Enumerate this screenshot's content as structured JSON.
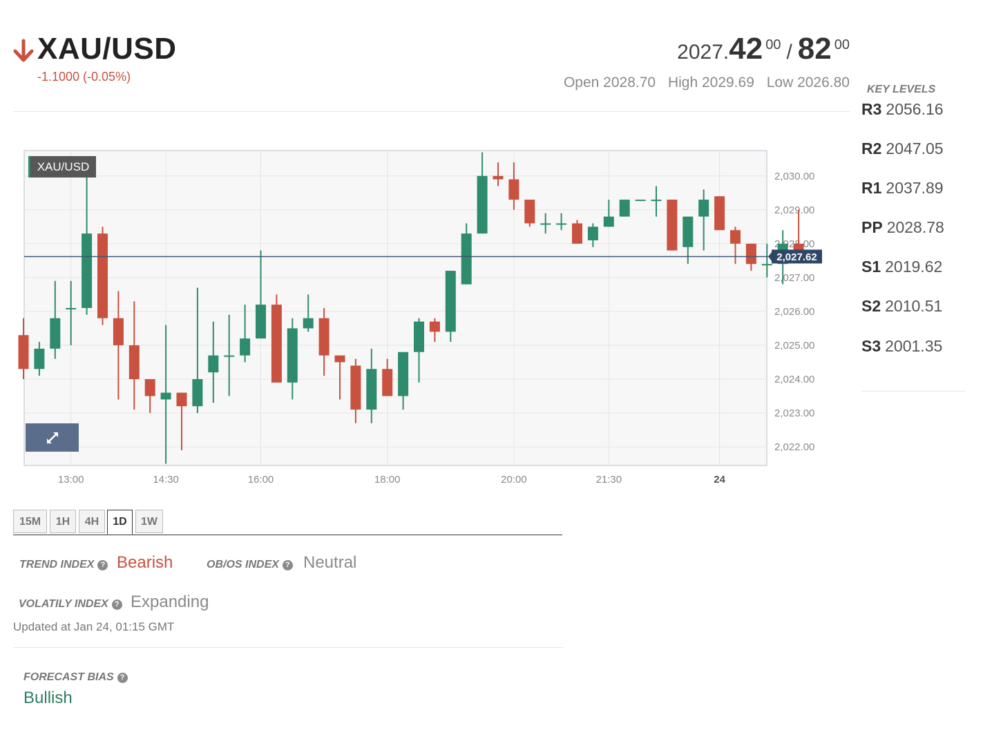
{
  "header": {
    "symbol": "XAU/USD",
    "change": "-1.1000 (-0.05%)",
    "bid_base": "2027.",
    "bid_big": "42",
    "bid_sup": "00",
    "slash": "/",
    "ask_big": "82",
    "ask_sup": "00",
    "open": "Open 2028.70",
    "high": "High 2029.69",
    "low": "Low 2026.80",
    "colors": {
      "down": "#c8513f",
      "up": "#2e8b6e"
    }
  },
  "key_levels": {
    "title": "KEY LEVELS",
    "items": [
      {
        "label": "R3",
        "value": "2056.16"
      },
      {
        "label": "R2",
        "value": "2047.05"
      },
      {
        "label": "R1",
        "value": "2037.89"
      },
      {
        "label": "PP",
        "value": "2028.78"
      },
      {
        "label": "S1",
        "value": "2019.62"
      },
      {
        "label": "S2",
        "value": "2010.51"
      },
      {
        "label": "S3",
        "value": "2001.35"
      }
    ]
  },
  "chart_data": {
    "type": "candlestick",
    "label": "XAU/USD",
    "current_price": 2027.62,
    "current_price_label": "2,027.62",
    "ylim": [
      2021.45,
      2030.75
    ],
    "y_ticks": [
      2022,
      2023,
      2024,
      2025,
      2026,
      2027,
      2028,
      2029,
      2030
    ],
    "y_tick_labels": [
      "2,022.00",
      "2,023.00",
      "2,024.00",
      "2,025.00",
      "2,026.00",
      "2,027.00",
      "2,028.00",
      "2,029.00",
      "2,030.00"
    ],
    "x_ticks": [
      {
        "label": "13:00",
        "index": 3,
        "bold": false
      },
      {
        "label": "14:30",
        "index": 9,
        "bold": false
      },
      {
        "label": "16:00",
        "index": 15,
        "bold": false
      },
      {
        "label": "18:00",
        "index": 23,
        "bold": false
      },
      {
        "label": "20:00",
        "index": 31,
        "bold": false
      },
      {
        "label": "21:30",
        "index": 37,
        "bold": false
      },
      {
        "label": "24",
        "index": 44,
        "bold": true
      }
    ],
    "candles": [
      {
        "o": 2025.3,
        "h": 2025.8,
        "l": 2024.0,
        "c": 2024.3
      },
      {
        "o": 2024.3,
        "h": 2025.1,
        "l": 2024.1,
        "c": 2024.9
      },
      {
        "o": 2024.9,
        "h": 2026.9,
        "l": 2024.6,
        "c": 2025.8
      },
      {
        "o": 2026.1,
        "h": 2026.9,
        "l": 2025.0,
        "c": 2026.1
      },
      {
        "o": 2026.1,
        "h": 2030.0,
        "l": 2025.9,
        "c": 2028.3
      },
      {
        "o": 2028.3,
        "h": 2028.5,
        "l": 2025.6,
        "c": 2025.8
      },
      {
        "o": 2025.8,
        "h": 2026.6,
        "l": 2023.4,
        "c": 2025.0
      },
      {
        "o": 2025.0,
        "h": 2026.3,
        "l": 2023.1,
        "c": 2024.0
      },
      {
        "o": 2024.0,
        "h": 2024.0,
        "l": 2023.0,
        "c": 2023.5
      },
      {
        "o": 2023.4,
        "h": 2025.6,
        "l": 2021.5,
        "c": 2023.6
      },
      {
        "o": 2023.6,
        "h": 2023.6,
        "l": 2021.9,
        "c": 2023.2
      },
      {
        "o": 2023.2,
        "h": 2026.7,
        "l": 2023.0,
        "c": 2024.0
      },
      {
        "o": 2024.2,
        "h": 2025.7,
        "l": 2023.3,
        "c": 2024.7
      },
      {
        "o": 2024.7,
        "h": 2025.9,
        "l": 2023.5,
        "c": 2024.7
      },
      {
        "o": 2024.7,
        "h": 2026.2,
        "l": 2024.5,
        "c": 2025.2
      },
      {
        "o": 2025.2,
        "h": 2027.8,
        "l": 2025.2,
        "c": 2026.2
      },
      {
        "o": 2026.2,
        "h": 2026.5,
        "l": 2023.9,
        "c": 2023.9
      },
      {
        "o": 2023.9,
        "h": 2025.8,
        "l": 2023.4,
        "c": 2025.5
      },
      {
        "o": 2025.5,
        "h": 2026.5,
        "l": 2025.4,
        "c": 2025.8
      },
      {
        "o": 2025.8,
        "h": 2026.1,
        "l": 2024.1,
        "c": 2024.7
      },
      {
        "o": 2024.7,
        "h": 2024.7,
        "l": 2023.4,
        "c": 2024.5
      },
      {
        "o": 2024.4,
        "h": 2024.6,
        "l": 2022.7,
        "c": 2023.1
      },
      {
        "o": 2023.1,
        "h": 2024.9,
        "l": 2022.7,
        "c": 2024.3
      },
      {
        "o": 2024.3,
        "h": 2024.6,
        "l": 2023.5,
        "c": 2023.5
      },
      {
        "o": 2023.5,
        "h": 2024.8,
        "l": 2023.1,
        "c": 2024.8
      },
      {
        "o": 2024.8,
        "h": 2025.8,
        "l": 2023.9,
        "c": 2025.7
      },
      {
        "o": 2025.7,
        "h": 2025.8,
        "l": 2025.1,
        "c": 2025.4
      },
      {
        "o": 2025.4,
        "h": 2027.2,
        "l": 2025.1,
        "c": 2027.2
      },
      {
        "o": 2026.8,
        "h": 2028.6,
        "l": 2026.8,
        "c": 2028.3
      },
      {
        "o": 2028.3,
        "h": 2030.7,
        "l": 2028.3,
        "c": 2030.0
      },
      {
        "o": 2030.0,
        "h": 2030.4,
        "l": 2029.7,
        "c": 2029.9
      },
      {
        "o": 2029.9,
        "h": 2030.4,
        "l": 2029.0,
        "c": 2029.3
      },
      {
        "o": 2029.3,
        "h": 2029.3,
        "l": 2028.5,
        "c": 2028.6
      },
      {
        "o": 2028.6,
        "h": 2028.9,
        "l": 2028.3,
        "c": 2028.6
      },
      {
        "o": 2028.6,
        "h": 2028.9,
        "l": 2028.4,
        "c": 2028.6
      },
      {
        "o": 2028.6,
        "h": 2028.7,
        "l": 2028.0,
        "c": 2028.0
      },
      {
        "o": 2028.1,
        "h": 2028.6,
        "l": 2027.9,
        "c": 2028.5
      },
      {
        "o": 2028.5,
        "h": 2029.3,
        "l": 2028.5,
        "c": 2028.8
      },
      {
        "o": 2028.8,
        "h": 2029.3,
        "l": 2028.8,
        "c": 2029.3
      },
      {
        "o": 2029.3,
        "h": 2029.3,
        "l": 2029.3,
        "c": 2029.3
      },
      {
        "o": 2029.3,
        "h": 2029.7,
        "l": 2028.8,
        "c": 2029.3
      },
      {
        "o": 2029.3,
        "h": 2029.3,
        "l": 2027.8,
        "c": 2027.8
      },
      {
        "o": 2027.9,
        "h": 2028.8,
        "l": 2027.4,
        "c": 2028.8
      },
      {
        "o": 2028.8,
        "h": 2029.6,
        "l": 2027.8,
        "c": 2029.3
      },
      {
        "o": 2029.4,
        "h": 2029.4,
        "l": 2028.4,
        "c": 2028.4
      },
      {
        "o": 2028.4,
        "h": 2028.5,
        "l": 2027.4,
        "c": 2028.0
      },
      {
        "o": 2028.0,
        "h": 2028.0,
        "l": 2027.2,
        "c": 2027.4
      },
      {
        "o": 2027.4,
        "h": 2028.0,
        "l": 2027.0,
        "c": 2027.4
      },
      {
        "o": 2027.4,
        "h": 2028.4,
        "l": 2026.8,
        "c": 2028.0
      },
      {
        "o": 2028.0,
        "h": 2029.0,
        "l": 2027.5,
        "c": 2027.6
      }
    ]
  },
  "timeframes": {
    "items": [
      "15M",
      "1H",
      "4H",
      "1D",
      "1W"
    ],
    "active": "1D"
  },
  "indices": {
    "trend_label": "TREND INDEX",
    "trend_value": "Bearish",
    "obos_label": "OB/OS INDEX",
    "obos_value": "Neutral",
    "vol_label": "VOLATILY INDEX",
    "vol_value": "Expanding",
    "updated": "Updated at Jan 24, 01:15 GMT",
    "forecast_label": "FORECAST BIAS",
    "forecast_value": "Bullish",
    "help_glyph": "?",
    "colors": {
      "bearish": "#c8513f",
      "neutral": "#8a8a8a",
      "bullish": "#2e7d5e"
    }
  }
}
